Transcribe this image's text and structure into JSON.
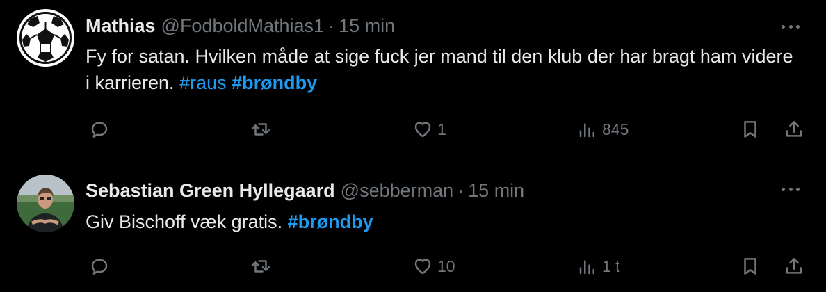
{
  "tweets": [
    {
      "name": "Mathias",
      "handle": "@FodboldMathias1",
      "separator": "·",
      "time": "15 min",
      "text": "Fy for satan. Hvilken måde at sige fuck jer mand til den klub der har bragt ham videre i karrieren.",
      "hashtags": [
        "#raus",
        "#brøndby"
      ],
      "avatar": "soccer-ball-avatar",
      "stats": {
        "replies": "",
        "retweets": "",
        "likes": "1",
        "views": "845"
      }
    },
    {
      "name": "Sebastian Green Hyllegaard",
      "handle": "@sebberman",
      "separator": "·",
      "time": "15 min",
      "text": "Giv Bischoff væk gratis.",
      "hashtags": [
        "#brøndby"
      ],
      "avatar": "profile-photo-avatar",
      "stats": {
        "replies": "",
        "retweets": "",
        "likes": "10",
        "views": "1 t"
      }
    }
  ],
  "colors": {
    "background": "#000000",
    "text": "#e7e9ea",
    "muted": "#71767b",
    "link": "#1d9bf0",
    "divider": "#2f3336"
  },
  "icons": [
    "reply-icon",
    "retweet-icon",
    "like-icon",
    "views-icon",
    "bookmark-icon",
    "share-icon",
    "more-icon"
  ]
}
